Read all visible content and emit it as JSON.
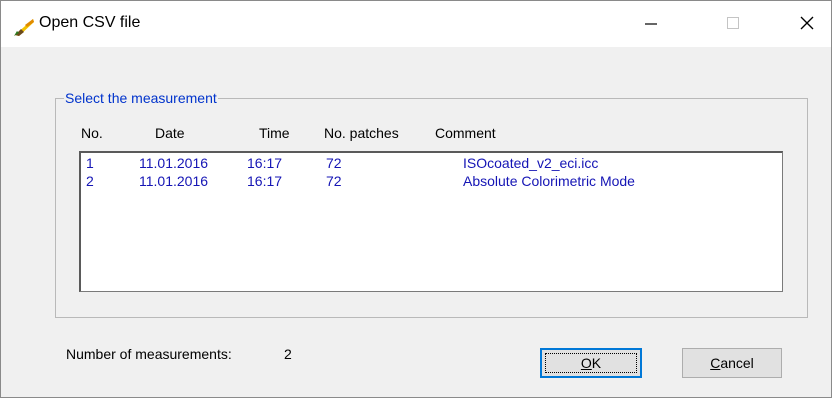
{
  "window": {
    "title": "Open CSV file",
    "controls": {
      "minimize": "minimize",
      "maximize": "maximize",
      "close": "close"
    }
  },
  "group": {
    "label": "Select the measurement",
    "columns": [
      "No.",
      "Date",
      "Time",
      "No. patches",
      "Comment"
    ]
  },
  "measurements": [
    {
      "no": "1",
      "date": "11.01.2016",
      "time": "16:17",
      "patches": "72",
      "comment": "ISOcoated_v2_eci.icc"
    },
    {
      "no": "2",
      "date": "11.01.2016",
      "time": "16:17",
      "patches": "72",
      "comment": "Absolute Colorimetric Mode"
    }
  ],
  "footer": {
    "count_label": "Number of measurements:",
    "count_value": "2"
  },
  "buttons": {
    "ok_label": "OK",
    "cancel_label": "Cancel"
  },
  "colors": {
    "list_text": "#1515b5",
    "group_label": "#0033cc",
    "default_button_border": "#0078d7"
  },
  "icons": {
    "app": "brush-icon",
    "minimize": "minimize-icon",
    "maximize": "maximize-icon",
    "close": "close-icon"
  }
}
